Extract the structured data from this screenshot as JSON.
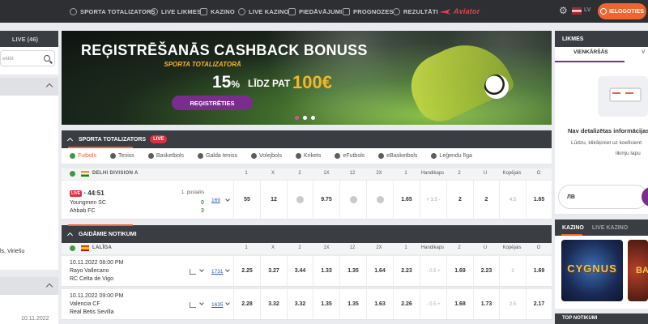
{
  "nav": {
    "items": [
      {
        "label": "SPORTA TOTALIZATORS",
        "icon": "soccer-ball-icon"
      },
      {
        "label": "LIVE LIKMES",
        "icon": "live-icon"
      },
      {
        "label": "KAZINO",
        "icon": "casino-icon"
      },
      {
        "label": "LIVE KAZINO",
        "icon": "live-casino-icon"
      },
      {
        "label": "PIEDĀVĀJUMI",
        "icon": "offers-icon"
      },
      {
        "label": "PROGNOZES",
        "icon": "predictions-icon"
      },
      {
        "label": "REZULTĀTI",
        "icon": "results-icon"
      }
    ],
    "aviator": "Aviator",
    "language": "LV",
    "login": "IELOGOTIES",
    "accent": "#f0642f"
  },
  "left": {
    "live_header": "LIVE (46)",
    "search_placeholder": "eklēt",
    "item_text": "ls, Viriešu",
    "date": "10.11.2022"
  },
  "banner": {
    "title": "REĢISTRĒŠANĀS CASHBACK BONUSS",
    "subtitle": "SPORTA TOTALIZATORĀ",
    "percent": "15",
    "percent_sign": "%",
    "up_to": "LĪDZ PAT",
    "amount": "100€",
    "button": "REĢISTRĒTIES",
    "slides": 3,
    "active_slide": 1
  },
  "sportsbook": {
    "title": "SPORTA TOTALIZATORS",
    "live_badge": "LIVE",
    "tabs": [
      "Futbols",
      "Teniss",
      "Basketbols",
      "Galda teniss",
      "Volejbols",
      "Krikets",
      "eFutbols",
      "eBasketbols",
      "Leģendu līga"
    ],
    "active_tab": 0,
    "columns": [
      "1",
      "X",
      "2",
      "1X",
      "12",
      "2X",
      "1",
      "Handikaps",
      "2",
      "U",
      "Kopējais",
      "O"
    ],
    "live_league": "DELHI DIVISION A",
    "live_match": {
      "tag": "LIVE",
      "time": "44:51",
      "period": "1. puslaiks",
      "home": "Youngmen SC",
      "away": "Ahbab FC",
      "home_score": "0",
      "away_score": "3",
      "markets": "169",
      "odds": [
        "55",
        "12",
        "",
        "9.75",
        "",
        "",
        "1.65",
        "+ 3.5 -",
        "2",
        "2",
        "4.5",
        "1.65"
      ]
    }
  },
  "upcoming": {
    "title": "GAIDĀMIE NOTIKUMI",
    "league": "LALĪGA",
    "matches": [
      {
        "datetime": "10.11.2022 08:00 PM",
        "home": "Rayo Vallecano",
        "away": "RC Celta de Vigo",
        "markets": "1731",
        "odds": [
          "2.25",
          "3.27",
          "3.44",
          "1.33",
          "1.35",
          "1.64",
          "2.23",
          "- 0.5 +",
          "1.69",
          "2.23",
          "2",
          "1.69"
        ]
      },
      {
        "datetime": "10.11.2022 09:00 PM",
        "home": "Valencia CF",
        "away": "Real Betis Sevilla",
        "markets": "1635",
        "odds": [
          "2.28",
          "3.32",
          "3.32",
          "1.35",
          "1.35",
          "1.63",
          "2.26",
          "- 0.5 +",
          "1.68",
          "1.73",
          "2.5",
          "2.17"
        ]
      }
    ]
  },
  "betslip": {
    "title": "LIKMES",
    "tab_single": "VIENKĀRŠĀS",
    "tab_multi": "V",
    "empty_title": "Nav detalizētas informācijas",
    "empty_text": "Lūdzu, klikšķiniet uz koeficient",
    "empty_text2": "likmju lapu",
    "amount_label": "ЛВ"
  },
  "casino": {
    "tab_casino": "KAZINO",
    "tab_live": "LIVE KAZINO",
    "game1": "CYGNUS",
    "game2": "BA",
    "bottom_title": "TOP NOTIKUMI"
  }
}
